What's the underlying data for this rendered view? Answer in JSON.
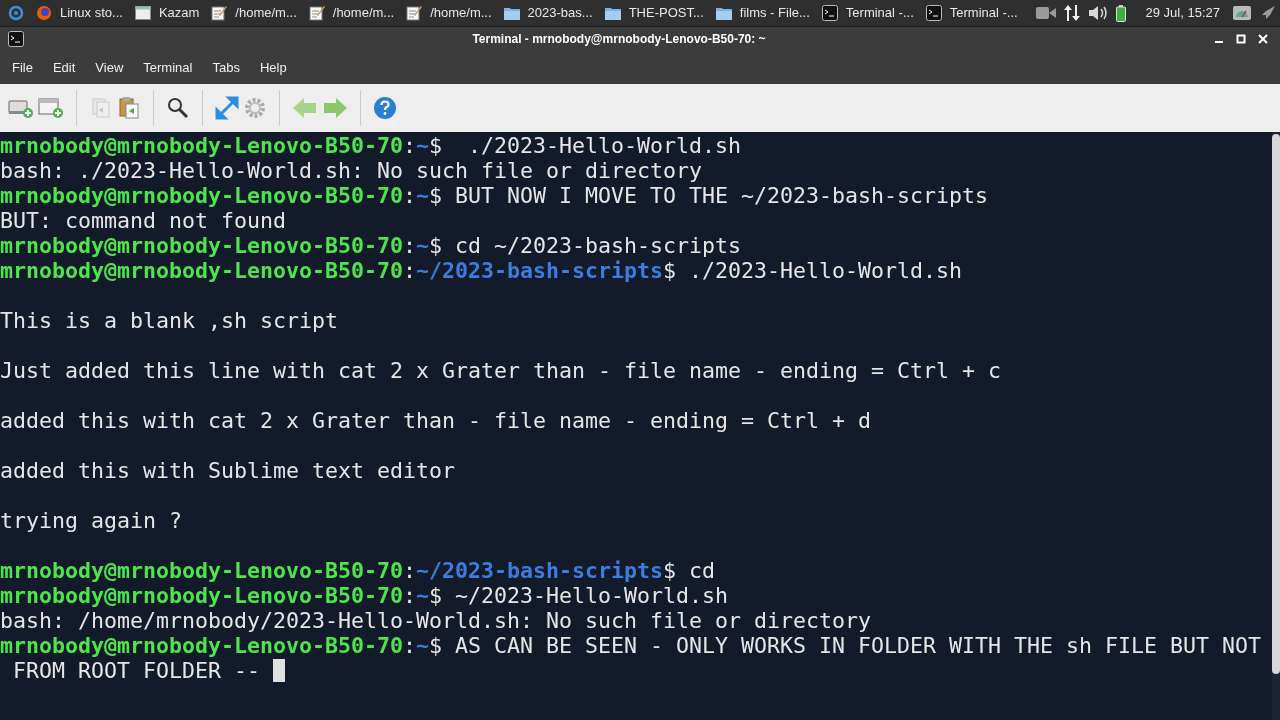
{
  "taskbar": {
    "items": [
      {
        "kind": "browser",
        "label": "Linux sto..."
      },
      {
        "kind": "window",
        "label": "Kazam"
      },
      {
        "kind": "editor",
        "label": "/home/m..."
      },
      {
        "kind": "editor",
        "label": "/home/m..."
      },
      {
        "kind": "editor",
        "label": "/home/m..."
      },
      {
        "kind": "folder",
        "label": "2023-bas..."
      },
      {
        "kind": "folder",
        "label": "THE-POST..."
      },
      {
        "kind": "folder",
        "label": "films - File..."
      },
      {
        "kind": "terminal",
        "label": "Terminal -..."
      },
      {
        "kind": "terminal",
        "label": "Terminal -..."
      }
    ],
    "clock": "29 Jul, 15:27"
  },
  "window": {
    "title": "Terminal - mrnobody@mrnobody-Lenovo-B50-70: ~"
  },
  "menu": [
    "File",
    "Edit",
    "View",
    "Terminal",
    "Tabs",
    "Help"
  ],
  "terminal": {
    "lines": [
      {
        "kind": "text",
        "segments": [
          {
            "kind": "user",
            "text": "mrnobody@mrnobody-Lenovo-B50-70"
          },
          {
            "kind": "sep",
            "text": ":"
          },
          {
            "kind": "path",
            "text": "~"
          },
          {
            "kind": "plain",
            "text": "$  ./2023-Hello-World.sh"
          }
        ]
      },
      {
        "kind": "text",
        "segments": [
          {
            "kind": "plain",
            "text": "bash: ./2023-Hello-World.sh: No such file or directory"
          }
        ]
      },
      {
        "kind": "text",
        "segments": [
          {
            "kind": "user",
            "text": "mrnobody@mrnobody-Lenovo-B50-70"
          },
          {
            "kind": "sep",
            "text": ":"
          },
          {
            "kind": "path",
            "text": "~"
          },
          {
            "kind": "plain",
            "text": "$ BUT NOW I MOVE TO THE ~/2023-bash-scripts"
          }
        ]
      },
      {
        "kind": "text",
        "segments": [
          {
            "kind": "plain",
            "text": "BUT: command not found"
          }
        ]
      },
      {
        "kind": "text",
        "segments": [
          {
            "kind": "user",
            "text": "mrnobody@mrnobody-Lenovo-B50-70"
          },
          {
            "kind": "sep",
            "text": ":"
          },
          {
            "kind": "path",
            "text": "~"
          },
          {
            "kind": "plain",
            "text": "$ cd ~/2023-bash-scripts"
          }
        ]
      },
      {
        "kind": "text",
        "segments": [
          {
            "kind": "user",
            "text": "mrnobody@mrnobody-Lenovo-B50-70"
          },
          {
            "kind": "sep",
            "text": ":"
          },
          {
            "kind": "path",
            "text": "~/2023-bash-scripts"
          },
          {
            "kind": "plain",
            "text": "$ ./2023-Hello-World.sh"
          }
        ]
      },
      {
        "kind": "blank"
      },
      {
        "kind": "text",
        "segments": [
          {
            "kind": "plain",
            "text": "This is a blank ,sh script"
          }
        ]
      },
      {
        "kind": "blank"
      },
      {
        "kind": "text",
        "segments": [
          {
            "kind": "plain",
            "text": "Just added this line with cat 2 x Grater than - file name - ending = Ctrl + c"
          }
        ]
      },
      {
        "kind": "blank"
      },
      {
        "kind": "text",
        "segments": [
          {
            "kind": "plain",
            "text": "added this with cat 2 x Grater than - file name - ending = Ctrl + d"
          }
        ]
      },
      {
        "kind": "blank"
      },
      {
        "kind": "text",
        "segments": [
          {
            "kind": "plain",
            "text": "added this with Sublime text editor"
          }
        ]
      },
      {
        "kind": "blank"
      },
      {
        "kind": "text",
        "segments": [
          {
            "kind": "plain",
            "text": "trying again ?"
          }
        ]
      },
      {
        "kind": "blank"
      },
      {
        "kind": "text",
        "segments": [
          {
            "kind": "user",
            "text": "mrnobody@mrnobody-Lenovo-B50-70"
          },
          {
            "kind": "sep",
            "text": ":"
          },
          {
            "kind": "path",
            "text": "~/2023-bash-scripts"
          },
          {
            "kind": "plain",
            "text": "$ cd"
          }
        ]
      },
      {
        "kind": "text",
        "segments": [
          {
            "kind": "user",
            "text": "mrnobody@mrnobody-Lenovo-B50-70"
          },
          {
            "kind": "sep",
            "text": ":"
          },
          {
            "kind": "path",
            "text": "~"
          },
          {
            "kind": "plain",
            "text": "$ ~/2023-Hello-World.sh"
          }
        ]
      },
      {
        "kind": "text",
        "segments": [
          {
            "kind": "plain",
            "text": "bash: /home/mrnobody/2023-Hello-World.sh: No such file or directory"
          }
        ]
      },
      {
        "kind": "text",
        "segments": [
          {
            "kind": "user",
            "text": "mrnobody@mrnobody-Lenovo-B50-70"
          },
          {
            "kind": "sep",
            "text": ":"
          },
          {
            "kind": "path",
            "text": "~"
          },
          {
            "kind": "plain",
            "text": "$ AS CAN BE SEEN - ONLY WORKS IN FOLDER WITH THE sh FILE BUT NOT"
          }
        ]
      },
      {
        "kind": "cursor",
        "segments": [
          {
            "kind": "plain",
            "text": " FROM ROOT FOLDER -- "
          }
        ]
      }
    ]
  }
}
